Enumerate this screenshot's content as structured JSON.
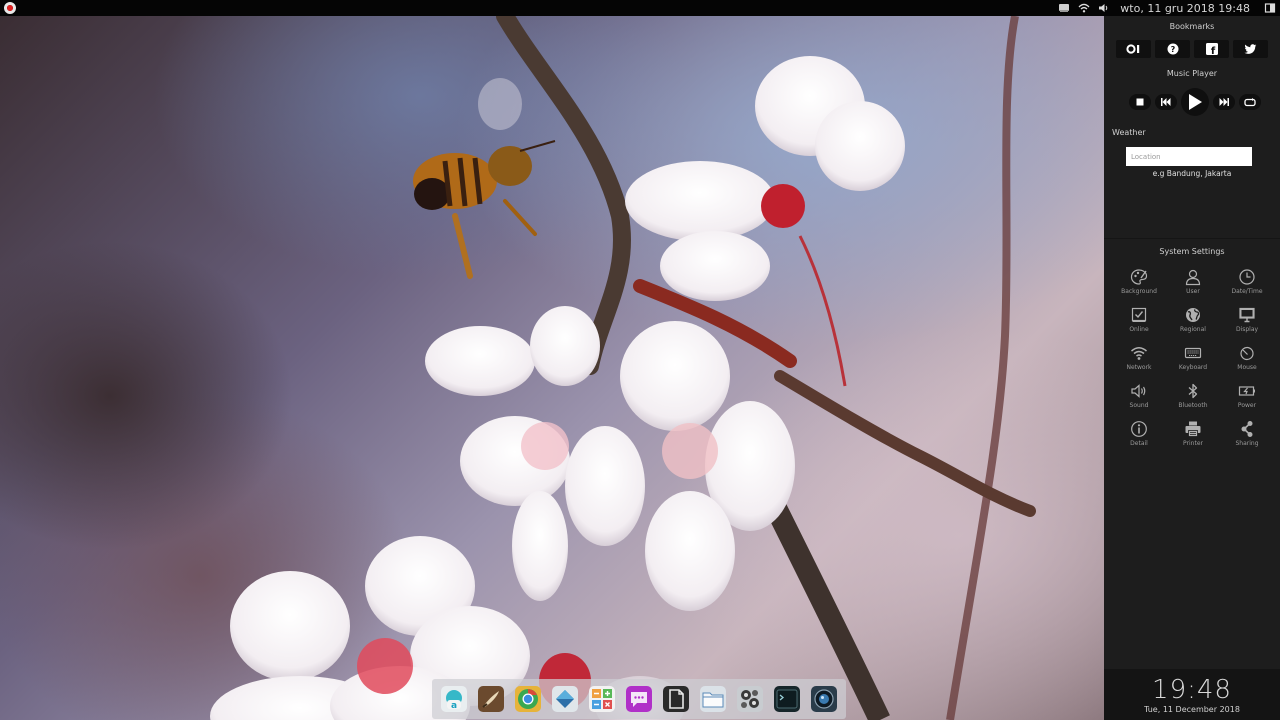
{
  "topbar": {
    "datetime": "wto, 11 gru 2018 19:48",
    "icons": [
      "menu-logo",
      "keyboard-layout-icon",
      "wifi-icon",
      "volume-icon",
      "window-toggle-icon"
    ]
  },
  "sidepanel": {
    "bookmarks": {
      "title": "Bookmarks",
      "items": [
        {
          "icon": "opera-icon",
          "label": "O|"
        },
        {
          "icon": "help-icon",
          "label": "?"
        },
        {
          "icon": "facebook-icon",
          "label": "f"
        },
        {
          "icon": "twitter-icon",
          "label": ""
        }
      ]
    },
    "music_player": {
      "title": "Music Player",
      "controls": [
        "stop-icon",
        "previous-icon",
        "play-icon",
        "next-icon",
        "repeat-icon"
      ]
    },
    "weather": {
      "title": "Weather",
      "location_placeholder": "Location",
      "location_value": "",
      "hint": "e.g Bandung, Jakarta"
    },
    "system_settings": {
      "title": "System Settings",
      "items": [
        {
          "label": "Background",
          "icon": "palette-icon"
        },
        {
          "label": "User",
          "icon": "user-icon"
        },
        {
          "label": "Date/Time",
          "icon": "clock-icon"
        },
        {
          "label": "Online",
          "icon": "online-icon"
        },
        {
          "label": "Regional",
          "icon": "globe-icon"
        },
        {
          "label": "Display",
          "icon": "monitor-icon"
        },
        {
          "label": "Network",
          "icon": "wifi-icon"
        },
        {
          "label": "Keyboard",
          "icon": "keyboard-icon"
        },
        {
          "label": "Mouse",
          "icon": "mouse-icon"
        },
        {
          "label": "Sound",
          "icon": "speaker-icon"
        },
        {
          "label": "Bluetooth",
          "icon": "bluetooth-icon"
        },
        {
          "label": "Power",
          "icon": "battery-icon"
        },
        {
          "label": "Detail",
          "icon": "info-icon"
        },
        {
          "label": "Printer",
          "icon": "printer-icon"
        },
        {
          "label": "Sharing",
          "icon": "sharing-icon"
        }
      ]
    },
    "clock": {
      "time": "19:48",
      "date": "Tue, 11 December 2018"
    }
  },
  "dock": {
    "apps": [
      {
        "name": "app-store",
        "color": "#e8eef0"
      },
      {
        "name": "gimp",
        "color": "#6b4a2e"
      },
      {
        "name": "chrome",
        "color": "#e8b43a"
      },
      {
        "name": "installer",
        "color": "#dfe6ea"
      },
      {
        "name": "calculator",
        "color": "#f0a040"
      },
      {
        "name": "messenger",
        "color": "#b030c8"
      },
      {
        "name": "text-editor",
        "color": "#2a2a2a"
      },
      {
        "name": "file-manager",
        "color": "#dde3e8"
      },
      {
        "name": "settings",
        "color": "#c8ccd0"
      },
      {
        "name": "terminal",
        "color": "#1a2a2c"
      },
      {
        "name": "camera",
        "color": "#2a3c4a"
      }
    ]
  }
}
